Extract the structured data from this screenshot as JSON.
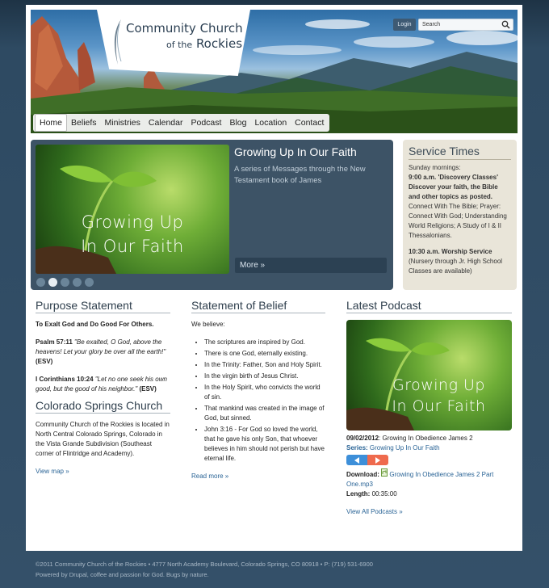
{
  "header": {
    "logo_line1": "Community Church",
    "logo_of_the": "of the",
    "logo_line2": "Rockies",
    "login_label": "Login",
    "search_value": "Search"
  },
  "nav": [
    "Home",
    "Beliefs",
    "Ministries",
    "Calendar",
    "Podcast",
    "Blog",
    "Location",
    "Contact"
  ],
  "slideshow": {
    "image_line1": "Growing Up",
    "image_line2": "In Our Faith",
    "title": "Growing Up In Our Faith",
    "description": "A series of Messages through the New Testament book of James",
    "more_label": "More »",
    "dots": 5,
    "active_dot": 2
  },
  "service_times": {
    "title": "Service Times",
    "sunday": "Sunday mornings:",
    "classes_bold": "9:00 a.m. 'Discovery Classes' Discover your faith, the Bible and other topics as posted.",
    "classes_list": "Connect With The Bible; Prayer: Connect With God; Understanding World Religions; A Study of I & II Thessalonians.",
    "worship_bold": "10:30 a.m.  Worship Service",
    "worship_note": "(Nursery through Jr. High School Classes are available)"
  },
  "purpose": {
    "title": "Purpose Statement",
    "lead": "To Exalt God and Do Good For Others.",
    "ref1": "Psalm 57:11",
    "quote1": "\"Be exalted, O God, above the heavens! Let your glory be over all the earth!\"",
    "ver1": "(ESV)",
    "ref2": "I Corinthians 10:24",
    "quote2": "\"Let no one seek his own good, but the good of his neighbor.\"",
    "ver2": "(ESV)"
  },
  "colorado": {
    "title": "Colorado Springs Church",
    "text": "Community Church of the Rockies is located in North Central Colorado Springs, Colorado in the Vista Grande Subdivision (Southeast corner of Flintridge and Academy).",
    "link": "View map »"
  },
  "belief": {
    "title": "Statement of Belief",
    "intro": "We believe:",
    "items": [
      "The scriptures are inspired by God.",
      "There is one God, eternally existing.",
      "In the Trinity: Father, Son and Holy Spirit.",
      "In the virgin birth of Jesus Christ.",
      "In the Holy Spirit, who convicts the world of sin.",
      "That mankind was created in the image of God, but sinned.",
      "John 3:16 - For God so loved the world, that he gave his only Son, that whoever believes in him should not perish but have eternal life."
    ],
    "link": "Read more »"
  },
  "podcast": {
    "title": "Latest Podcast",
    "image_line1": "Growing Up",
    "image_line2": "In Our Faith",
    "date": "09/02/2012",
    "episode": ": Growing In Obedience James 2",
    "series_label": "Series:",
    "series_link": "Growing Up In Our Faith",
    "download_label": "Download:",
    "download_link": "Growing In Obedience James 2 Part One.mp3",
    "length_label": "Length:",
    "length_value": "00:35:00",
    "view_all": "View All Podcasts »"
  },
  "footer": {
    "line1": "©2011 Community Church of the Rockies • 4777 North Academy Boulevard, Colorado Springs, CO 80918 • P: (719) 531-6900",
    "line2": "Powered by Drupal, coffee and passion for God. Bugs by nature."
  },
  "colors": {
    "slide_bg": "#3d5366",
    "service_bg": "#e9e5d9",
    "link": "#2a6496",
    "play_button": "#ef6a4d",
    "prev_button": "#3d8fd9"
  }
}
